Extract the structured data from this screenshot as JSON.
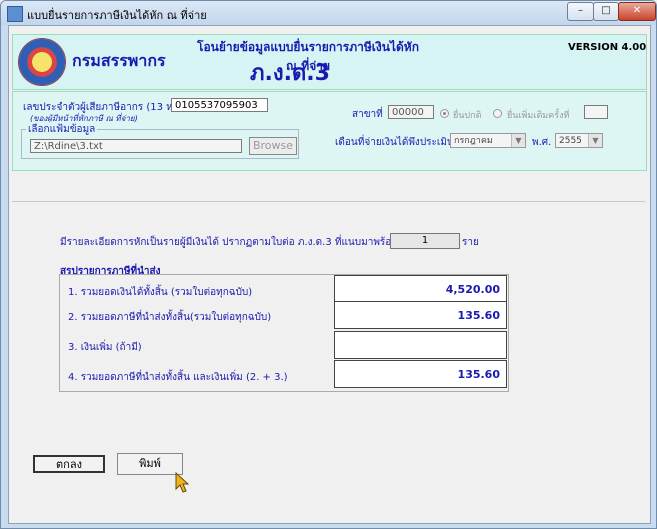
{
  "window": {
    "title": "แบบยื่นรายการภาษีเงินได้หัก ณ ที่จ่าย",
    "controls": {
      "minimize": "–",
      "maximize": "□",
      "close": "✕"
    }
  },
  "header": {
    "org_name": "กรมสรรพากร",
    "headline": "โอนย้ายข้อมูลแบบยื่นรายการภาษีเงินได้หัก ณ ที่จ่าย",
    "form_name": "ภ.ง.ด.3",
    "version": "VERSION 4.00"
  },
  "taxpayer": {
    "tax_id_label": "เลขประจำตัวผู้เสียภาษีอากร (13 หลัก)",
    "tax_id_note": "(ของผู้มีหน้าที่หักภาษี ณ ที่จ่าย)",
    "tax_id_value": "0105537095903",
    "branch_label": "สาขาที่",
    "branch_value": "00000",
    "radio_normal": "ยื่นปกติ",
    "radio_additional": "ยื่นเพิ่มเติมครั้งที่",
    "additional_value": "",
    "file_group_label": "เลือกแฟ้มข้อมูล",
    "file_path": "Z:\\Rdine\\3.txt",
    "browse_label": "Browse",
    "month_label": "เดือนที่จ่ายเงินได้พึงประเมิน",
    "month_value": "กรกฎาคม",
    "year_label": "พ.ศ.",
    "year_value": "2555"
  },
  "summary": {
    "intro": "มีรายละเอียดการหักเป็นรายผู้มีเงินได้ ปรากฏตามใบต่อ ภ.ง.ด.3 ที่แนบมาพร้อมนี้ จำนวน :",
    "count": "1",
    "unit": "ราย",
    "section_title": "สรุปรายการภาษีที่นำส่ง",
    "rows": [
      {
        "label": "1. รวมยอดเงินได้ทั้งสิ้น (รวมใบต่อทุกฉบับ)",
        "value": "4,520.00"
      },
      {
        "label": "2. รวมยอดภาษีที่นำส่งทั้งสิ้น(รวมใบต่อทุกฉบับ)",
        "value": "135.60"
      },
      {
        "label": "3. เงินเพิ่ม (ถ้ามี)",
        "value": ""
      },
      {
        "label": "4. รวมยอดภาษีที่นำส่งทั้งสิ้น และเงินเพิ่ม (2. + 3.)",
        "value": "135.60"
      }
    ]
  },
  "actions": {
    "ok_label": "ตกลง",
    "print_label": "พิมพ์"
  }
}
